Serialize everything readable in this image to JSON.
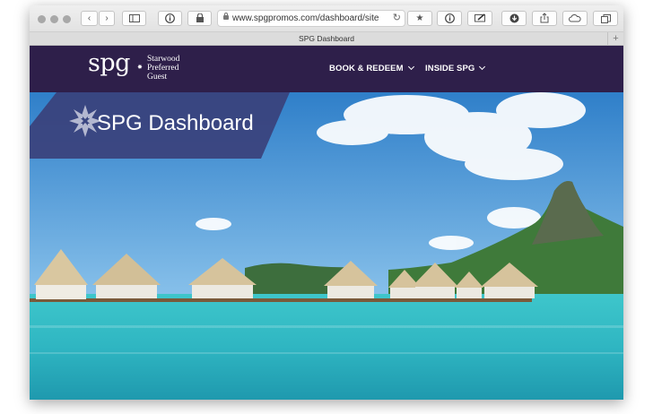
{
  "browser": {
    "url": "www.spgpromos.com/dashboard/site",
    "tab_title": "SPG Dashboard",
    "new_tab": "+",
    "back_icon": "chevron-left-icon",
    "forward_icon": "chevron-right-icon"
  },
  "nav": {
    "logo_text": "spg",
    "logo_line1": "Starwood",
    "logo_line2": "Preferred",
    "logo_line3": "Guest",
    "menu_book": "BOOK & REDEEM",
    "menu_inside": "INSIDE SPG"
  },
  "hero": {
    "title": "SPG Dashboard"
  },
  "colors": {
    "nav_bg": "#2e1f4a",
    "banner_bg": "#3a3f79",
    "water": "#3fc6cc"
  }
}
